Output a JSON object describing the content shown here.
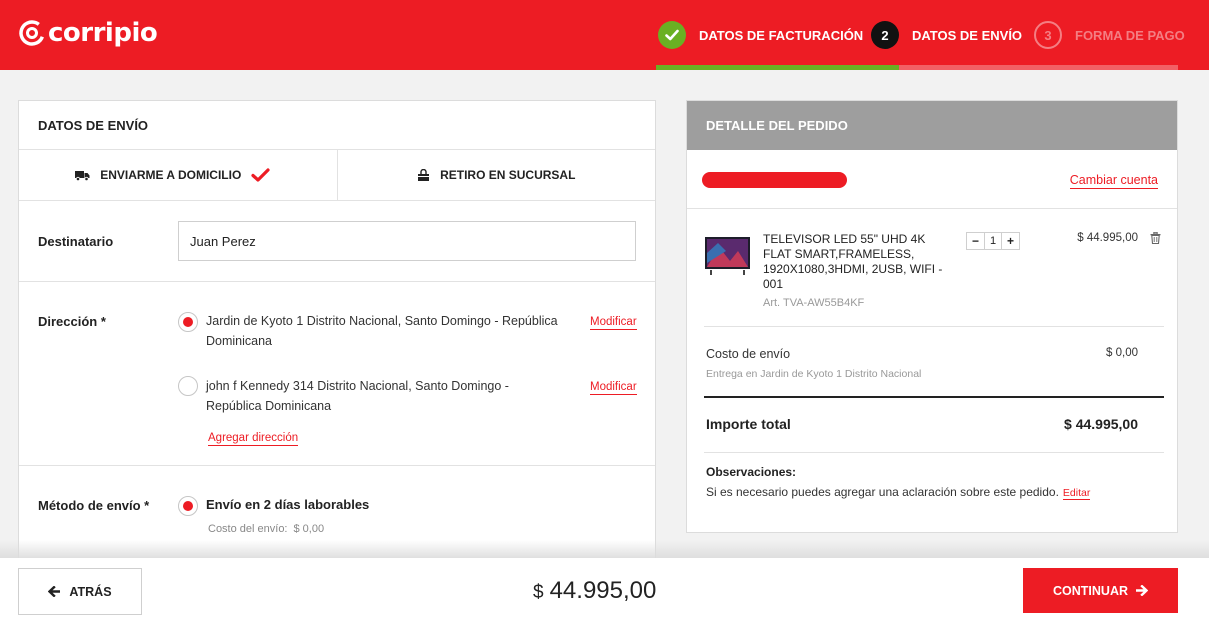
{
  "brand": {
    "name": "corripio",
    "accent": "#ed1c24",
    "success": "#6ab023"
  },
  "steps": [
    {
      "label": "DATOS DE FACTURACIÓN",
      "state": "done",
      "icon": "check-icon"
    },
    {
      "number": "2",
      "label": "DATOS DE ENVÍO",
      "state": "current"
    },
    {
      "number": "3",
      "label": "FORMA DE PAGO",
      "state": "pending"
    }
  ],
  "shipping": {
    "title": "DATOS DE ENVÍO",
    "tabs": [
      {
        "label": "ENVIARME A DOMICILIO",
        "icon": "truck-icon",
        "selected": true
      },
      {
        "label": "RETIRO EN SUCURSAL",
        "icon": "store-icon",
        "selected": false
      }
    ],
    "recipient": {
      "label": "Destinatario",
      "value": "Juan Perez"
    },
    "address": {
      "label": "Dirección *",
      "options": [
        {
          "text": "Jardin de Kyoto 1 Distrito Nacional, Santo Domingo - República Dominicana",
          "selected": true,
          "action": "Modificar"
        },
        {
          "text": "john f Kennedy 314 Distrito Nacional, Santo Domingo - República Dominicana",
          "selected": false,
          "action": "Modificar"
        }
      ],
      "add_label": "Agregar dirección"
    },
    "method": {
      "label": "Método de envío *",
      "option": "Envío en 2 días laborables",
      "cost_label": "Costo del envío:",
      "cost_value": "$ 0,00"
    }
  },
  "order": {
    "title": "DETALLE DEL PEDIDO",
    "change_account": "Cambiar cuenta",
    "product": {
      "name": "TELEVISOR LED 55\" UHD 4K FLAT SMART,FRAMELESS, 1920X1080,3HDMI, 2USB, WIFI - 001",
      "sku": "Art. TVA-AW55B4KF",
      "quantity": "1",
      "minus": "−",
      "plus": "+",
      "price": "$ 44.995,00"
    },
    "shipping_cost": {
      "label": "Costo de envío",
      "note": "Entrega en Jardin de Kyoto 1 Distrito Nacional",
      "value": "$ 0,00"
    },
    "total": {
      "label": "Importe total",
      "value": "$ 44.995,00"
    },
    "observations": {
      "title": "Observaciones:",
      "text": "Si es necesario puedes agregar una aclaración sobre este pedido.",
      "edit": "Editar"
    }
  },
  "footer": {
    "back": "ATRÁS",
    "currency": "$",
    "total": "44.995,00",
    "continue": "CONTINUAR"
  }
}
